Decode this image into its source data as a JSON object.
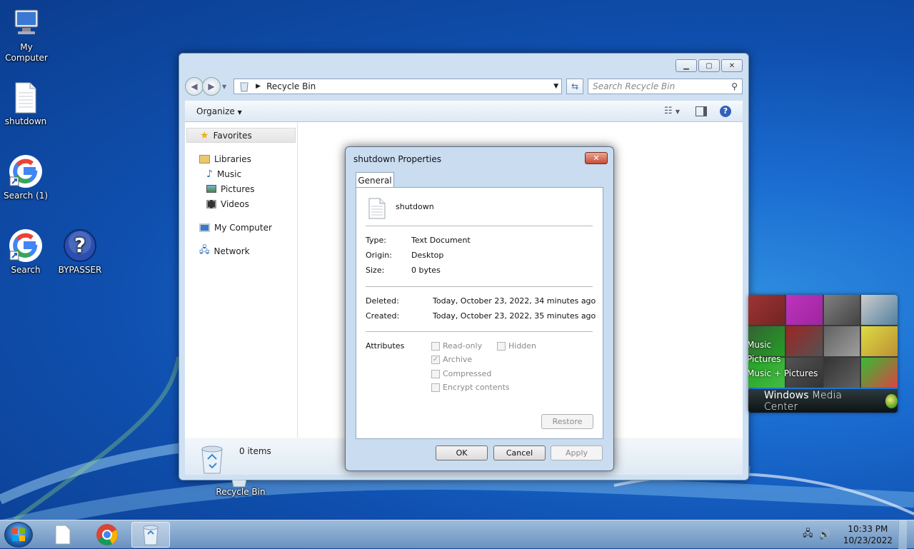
{
  "desktop": {
    "icons": [
      {
        "label": "My Computer",
        "icon": "computer-icon"
      },
      {
        "label": "shutdown",
        "icon": "text-file-icon"
      },
      {
        "label": "Search (1)",
        "icon": "google-icon"
      },
      {
        "label": "Search",
        "icon": "google-icon"
      },
      {
        "label": "BYPASSER",
        "icon": "help-icon"
      },
      {
        "label": "Recycle Bin",
        "icon": "recycle-bin-icon"
      }
    ]
  },
  "explorer": {
    "address": "Recycle Bin",
    "search_placeholder": "Search Recycle Bin",
    "organize": "Organize",
    "nav": {
      "favorites": "Favorites",
      "libraries": "Libraries",
      "music": "Music",
      "pictures": "Pictures",
      "videos": "Videos",
      "my_computer": "My Computer",
      "network": "Network"
    },
    "item_count": "0 items"
  },
  "properties": {
    "title": "shutdown Properties",
    "tab": "General",
    "file_name": "shutdown",
    "type_label": "Type:",
    "type_value": "Text Document",
    "origin_label": "Origin:",
    "origin_value": "Desktop",
    "size_label": "Size:",
    "size_value": "0 bytes",
    "deleted_label": "Deleted:",
    "deleted_value": "Today, October 23, 2022, 34 minutes ago",
    "created_label": "Created:",
    "created_value": "Today, October 23, 2022, 35 minutes ago",
    "attributes_label": "Attributes",
    "readonly": "Read-only",
    "hidden": "Hidden",
    "archive": "Archive",
    "compressed": "Compressed",
    "encrypt": "Encrypt contents",
    "restore": "Restore",
    "ok": "OK",
    "cancel": "Cancel",
    "apply": "Apply"
  },
  "media_center": {
    "items": [
      "Music",
      "Pictures",
      "Music + Pictures"
    ],
    "title_bold": "Windows",
    "title_rest": " Media Center"
  },
  "taskbar": {
    "time": "10:33 PM",
    "date": "10/23/2022"
  }
}
